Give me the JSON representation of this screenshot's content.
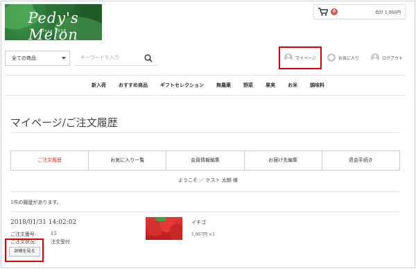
{
  "brand": {
    "name": "Pedy's Melon",
    "since": "Since 2016"
  },
  "cart": {
    "count": "0",
    "total": "合計 1,966円"
  },
  "search": {
    "category": "全ての商品",
    "placeholder": "キーワードを入力"
  },
  "user_links": {
    "mypage": "マイページ",
    "favorites": "お気に入り",
    "logout": "ログアウト"
  },
  "nav": [
    "新入荷",
    "おすすめ商品",
    "ギフトセレクション",
    "無農薬",
    "野菜",
    "果実",
    "お米",
    "調味料"
  ],
  "page_title": "マイページ/ご注文履歴",
  "tabs": [
    "ご注文履歴",
    "お気に入り一覧",
    "会員情報編集",
    "お届け先編集",
    "退会手続き"
  ],
  "welcome": "ようこそ ／ テスト 太朗 様",
  "history_count": "1件の履歴があります。",
  "order": {
    "date": "2018/01/31 14:02:02",
    "number_label": "ご注文番号:",
    "number": "15",
    "status_label": "ご注文状況:",
    "status": "注文受付",
    "detail_button": "詳細を見る"
  },
  "product": {
    "name": "イチゴ",
    "price": "1,967円 ×1"
  },
  "colors": {
    "accent": "#d9362f",
    "highlight": "#e00000"
  }
}
